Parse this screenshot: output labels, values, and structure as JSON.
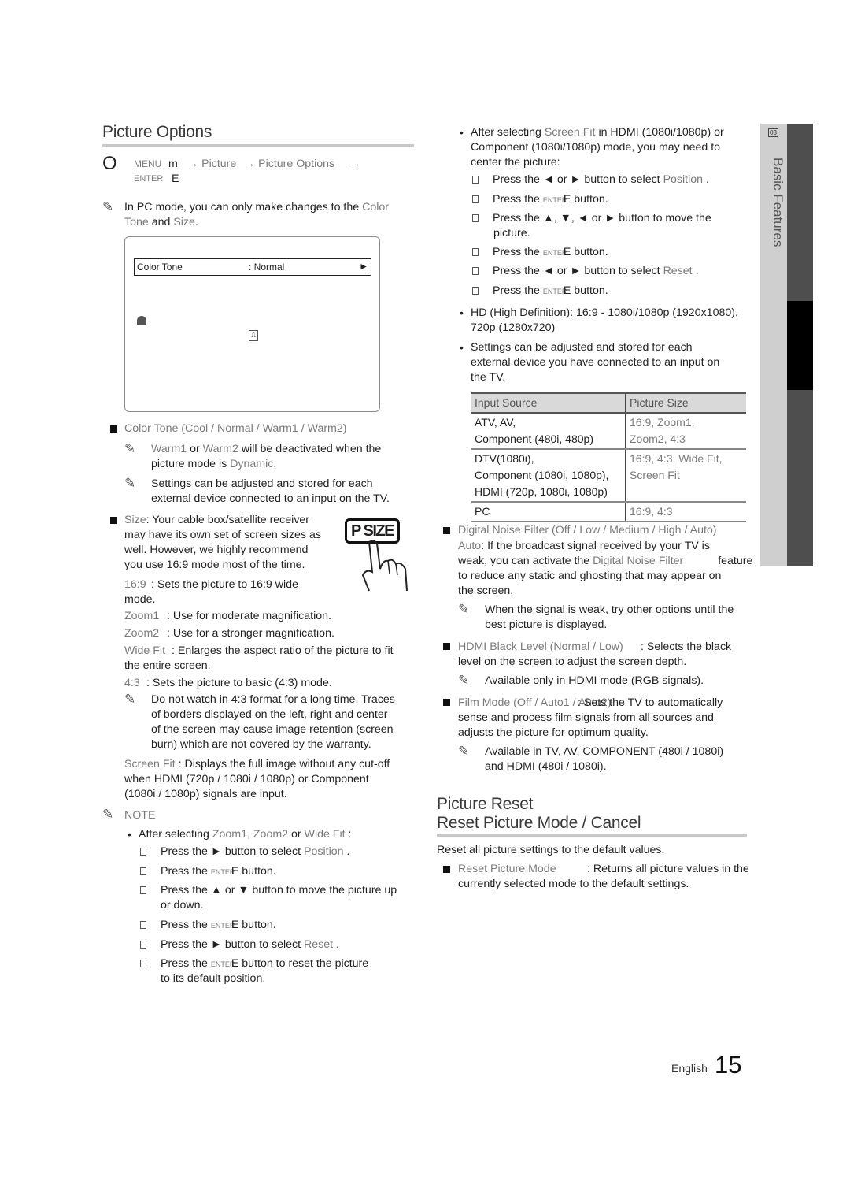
{
  "left": {
    "title": "Picture Options",
    "menu_path": {
      "icon": "O",
      "line1_a": "MENU",
      "line1_b": "m",
      "line1_c": "→ Picture",
      "line1_d": "→ Picture Options",
      "line1_e": "→",
      "line2_a": "ENTER",
      "line2_b": "E"
    },
    "pc_note": {
      "l1_a": "In ",
      "l1_b": "PC",
      "l1_c": " mode, you can only make changes to the ",
      "l1_d": "Color",
      "l2_a": "Tone",
      "l2_b": " and ",
      "l2_c": "Size",
      "l2_d": "."
    },
    "osd": {
      "row_label": "Color Tone",
      "row_value": ": Normal",
      "row_arrow": "►"
    },
    "color_tone": {
      "heading": "Color Tone (Cool / Normal / Warm1 / Warm2)",
      "note1_l1_a": "Warm1",
      "note1_l1_b": " or ",
      "note1_l1_c": "Warm2",
      "note1_l1_d": " will be deactivated when the",
      "note1_l2_a": "picture mode is ",
      "note1_l2_b": "Dynamic",
      "note1_l2_c": ".",
      "note2_l1": "Settings can be adjusted and stored for each",
      "note2_l2": "external device connected to an input on the TV."
    },
    "size": {
      "label": "Size",
      "l1": ": Your cable box/satellite receiver",
      "l2": "may have its own set of screen sizes as",
      "l3": "well. However, we highly recommend",
      "l4": "you use 16:9 mode most of the time.",
      "psize_button": "P SIZE",
      "opt_169_name": "16:9",
      "opt_169_desc": ": Sets the picture to 16:9 wide",
      "opt_169_desc2": "mode.",
      "opt_zoom1_name": "Zoom1",
      "opt_zoom1_desc": ": Use for moderate magnification.",
      "opt_zoom2_name": "Zoom2",
      "opt_zoom2_desc": ": Use for a stronger magnification.",
      "opt_wide_name": "Wide Fit",
      "opt_wide_desc": ": Enlarges the aspect ratio of the picture to fit",
      "opt_wide_desc2": "the entire screen.",
      "opt_43_name": "4:3",
      "opt_43_desc": ": Sets the picture to basic (4:3) mode.",
      "warn_l1": "Do not watch in 4:3 format for a long time. Traces",
      "warn_l2": "of borders displayed on the left, right and center",
      "warn_l3": "of the screen may cause image retention (screen",
      "warn_l4": "burn) which are not covered by the warranty.",
      "opt_sf_name": "Screen Fit",
      "opt_sf_desc": ": Displays the full image without any cut-off",
      "opt_sf_desc2": "when HDMI (720p / 1080i / 1080p) or Component",
      "opt_sf_desc3": "(1080i / 1080p) signals are input."
    },
    "pc_off_note": "NOTE",
    "position_steps": {
      "intro_a": "After selecting ",
      "intro_b": "Zoom1, Zoom2",
      "intro_c": " or ",
      "intro_d": "Wide Fit",
      "intro_e": ":",
      "steps": [
        {
          "a": "Press the ► button to select ",
          "b": "Position",
          "c": "."
        },
        {
          "a": "Press the ",
          "b": "ENTER",
          "c": "E",
          "d": " button."
        },
        {
          "a": "Press the ▲ or ▼ button to move the picture up",
          "a2": "or down."
        },
        {
          "a": "Press the ",
          "b": "ENTER",
          "c": "E",
          "d": " button."
        },
        {
          "a": "Press the ► button to select ",
          "b": "Reset",
          "c": "."
        },
        {
          "a": "Press the ",
          "b": "ENTER",
          "c": "E",
          "d": " button to reset the picture",
          "a2": "to its default position."
        }
      ]
    }
  },
  "right": {
    "screenfit_steps": {
      "intro_l1_a": "After selecting ",
      "intro_l1_b": "Screen Fit",
      "intro_l1_c": " in HDMI (1080i/1080p) or",
      "intro_l2": "Component (1080i/1080p) mode, you may need to",
      "intro_l3": "center the picture:",
      "steps": [
        {
          "a": "Press the ◄ or ► button to select ",
          "b": "Position",
          "c": "."
        },
        {
          "a": "Press the ",
          "b": "ENTER",
          "c": "E",
          "d": " button."
        },
        {
          "a": "Press the ▲, ▼, ◄ or ► button to move the",
          "a2": "picture."
        },
        {
          "a": "Press the ",
          "b": "ENTER",
          "c": "E",
          "d": " button."
        },
        {
          "a": "Press the ◄ or ► button to select ",
          "b": "Reset",
          "c": "."
        },
        {
          "a": "Press the ",
          "b": "ENTER",
          "c": "E",
          "d": " button."
        }
      ]
    },
    "hd_note_l1": "HD (High Definition): 16:9 - 1080i/1080p (1920x1080),",
    "hd_note_l2": "720p (1280x720)",
    "settings_note_l1": "Settings can be adjusted and stored for each",
    "settings_note_l2": "external device you have connected to an input on",
    "settings_note_l3": "the TV.",
    "table": {
      "headers": [
        "Input Source",
        "Picture Size"
      ],
      "rows": [
        {
          "source": [
            "ATV, AV,",
            "Component (480i, 480p)"
          ],
          "size": [
            "16:9, Zoom1,",
            "Zoom2, 4:3"
          ]
        },
        {
          "source": [
            "DTV(1080i),",
            "Component (1080i, 1080p),",
            "HDMI (720p, 1080i, 1080p)"
          ],
          "size": [
            "16:9, 4:3, Wide Fit,",
            "Screen Fit"
          ]
        },
        {
          "source": [
            "PC"
          ],
          "size": [
            "16:9, 4:3"
          ]
        }
      ]
    },
    "dnf": {
      "heading": "Digital Noise Filter (Off / Low / Medium / High / Auto)",
      "l1_a": "Auto",
      "l1_b": ": If the broadcast signal received by your TV is",
      "l2_a": "weak, you can activate the ",
      "l2_b": "Digital Noise Filter",
      "l2_c": " feature",
      "l3": "to reduce any static and ghosting that may appear on",
      "l4": "the screen.",
      "note_l1": "When the signal is weak, try other options until the",
      "note_l2": "best picture is displayed."
    },
    "hdmi_black": {
      "heading": "HDMI Black Level (Normal / Low)",
      "l1_b": ": Selects the black",
      "l2": "level on the screen to adjust the screen depth.",
      "note": "Available only in HDMI mode (RGB signals)."
    },
    "film_mode": {
      "heading": "Film Mode (Off / Auto1 / Auto2)",
      "l1_b": ": Sets the TV to automatically",
      "l2": "sense and process film signals from all sources and",
      "l3": "adjusts the picture for optimum quality.",
      "note_l1": "Available in TV, AV, COMPONENT (480i / 1080i)",
      "note_l2": "and HDMI (480i / 1080i)."
    },
    "reset": {
      "title_l1": "Picture Reset",
      "title_l2": "Reset Picture Mode / Cancel",
      "desc": "Reset all picture settings to the default values.",
      "item_name": "Reset Picture Mode",
      "item_l1": ": Returns all picture values in the",
      "item_l2": "currently selected mode to the default settings."
    }
  },
  "sidebar": {
    "chapter_number": "03",
    "label": "Basic Features"
  },
  "footer": {
    "language": "English",
    "page_number": "15"
  }
}
